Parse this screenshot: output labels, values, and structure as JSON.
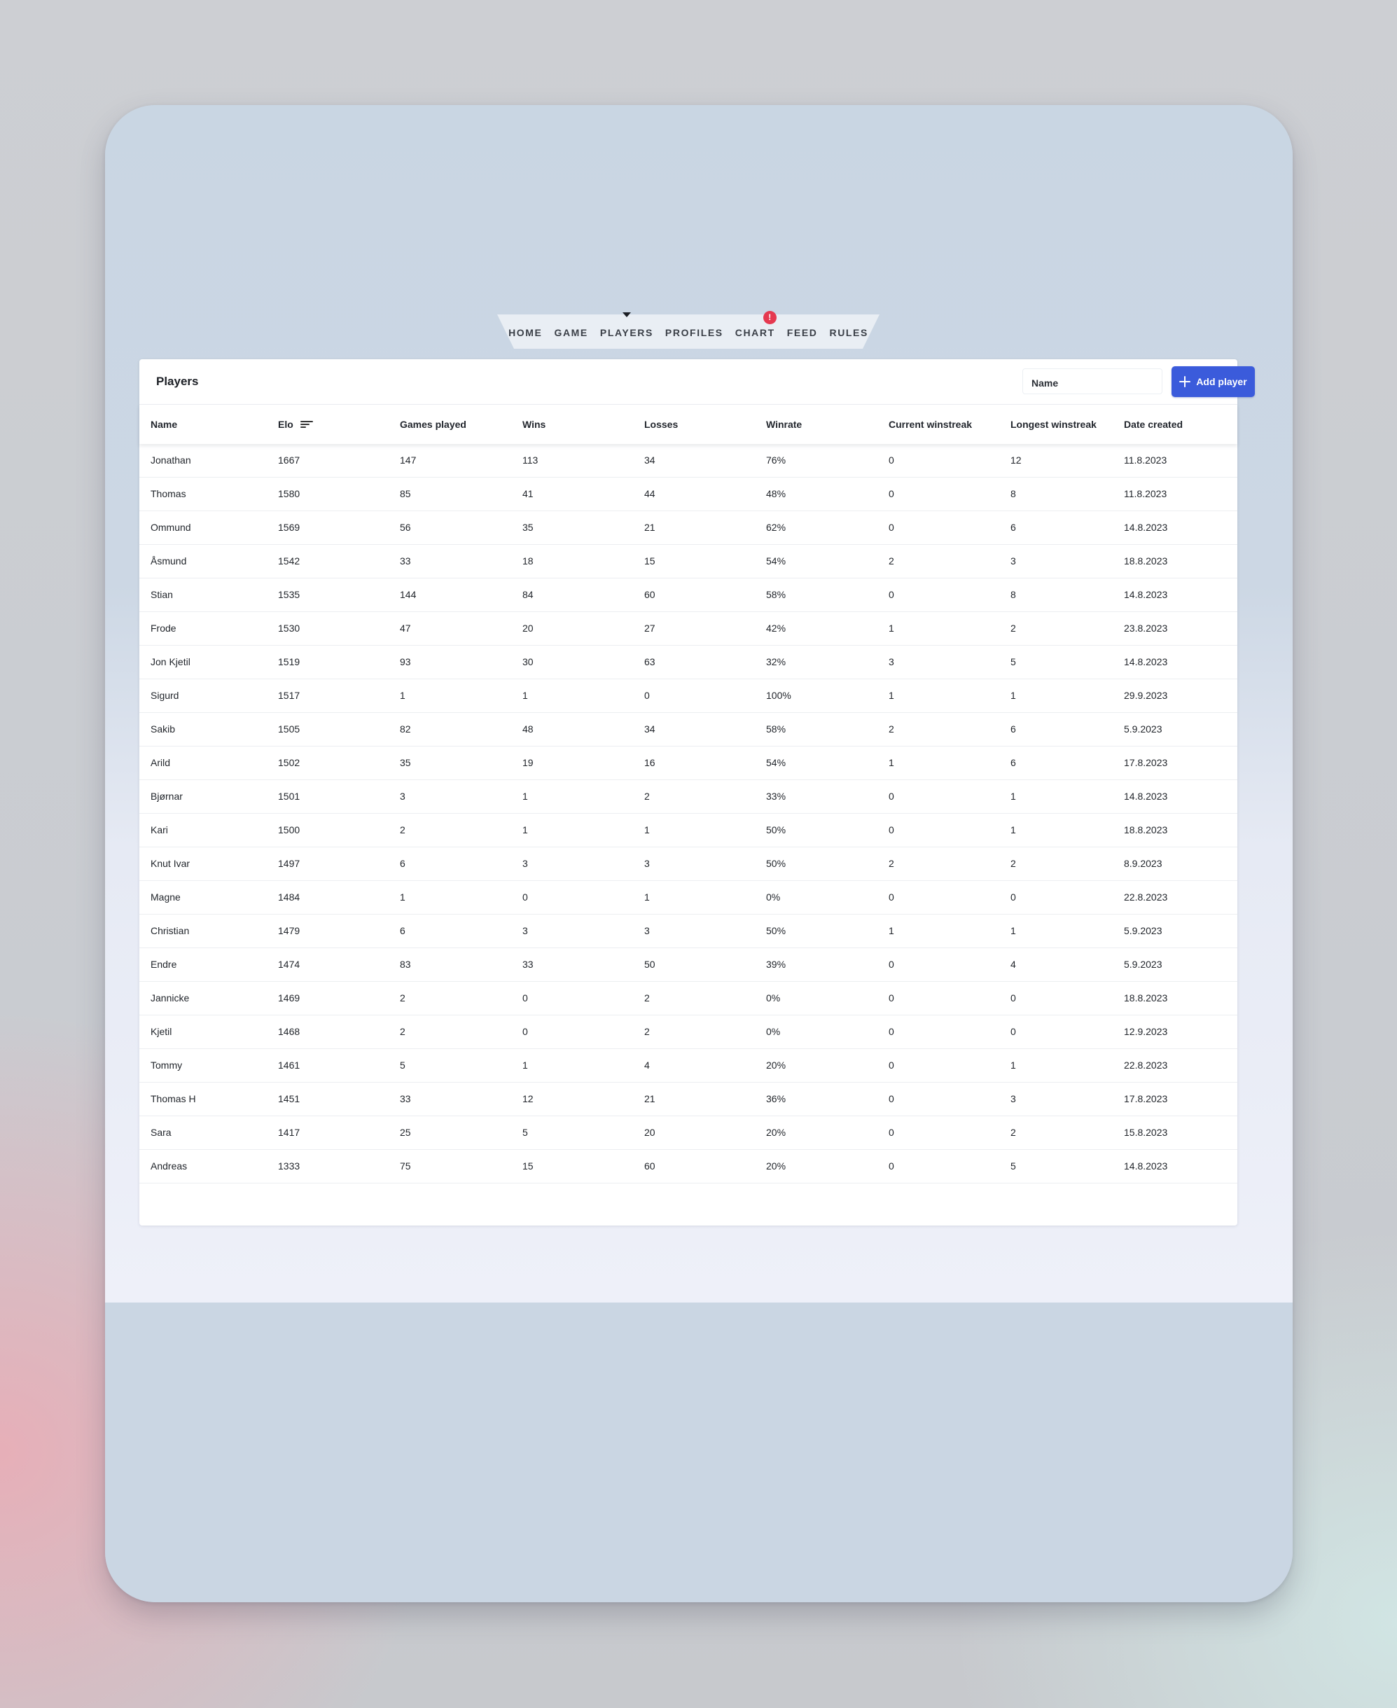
{
  "nav": {
    "items": [
      "HOME",
      "GAME",
      "PLAYERS",
      "PROFILES",
      "CHART",
      "FEED",
      "RULES"
    ],
    "active": "PLAYERS",
    "badge": "!"
  },
  "panel": {
    "title": "Players",
    "search_placeholder": "Name",
    "add_button_label": "Add player"
  },
  "table": {
    "columns": [
      "Name",
      "Elo",
      "Games played",
      "Wins",
      "Losses",
      "Winrate",
      "Current winstreak",
      "Longest winstreak",
      "Date created"
    ],
    "sorted_by": "Elo",
    "rows": [
      [
        "Jonathan",
        "1667",
        "147",
        "113",
        "34",
        "76%",
        "0",
        "12",
        "11.8.2023"
      ],
      [
        "Thomas",
        "1580",
        "85",
        "41",
        "44",
        "48%",
        "0",
        "8",
        "11.8.2023"
      ],
      [
        "Ommund",
        "1569",
        "56",
        "35",
        "21",
        "62%",
        "0",
        "6",
        "14.8.2023"
      ],
      [
        "Åsmund",
        "1542",
        "33",
        "18",
        "15",
        "54%",
        "2",
        "3",
        "18.8.2023"
      ],
      [
        "Stian",
        "1535",
        "144",
        "84",
        "60",
        "58%",
        "0",
        "8",
        "14.8.2023"
      ],
      [
        "Frode",
        "1530",
        "47",
        "20",
        "27",
        "42%",
        "1",
        "2",
        "23.8.2023"
      ],
      [
        "Jon Kjetil",
        "1519",
        "93",
        "30",
        "63",
        "32%",
        "3",
        "5",
        "14.8.2023"
      ],
      [
        "Sigurd",
        "1517",
        "1",
        "1",
        "0",
        "100%",
        "1",
        "1",
        "29.9.2023"
      ],
      [
        "Sakib",
        "1505",
        "82",
        "48",
        "34",
        "58%",
        "2",
        "6",
        "5.9.2023"
      ],
      [
        "Arild",
        "1502",
        "35",
        "19",
        "16",
        "54%",
        "1",
        "6",
        "17.8.2023"
      ],
      [
        "Bjørnar",
        "1501",
        "3",
        "1",
        "2",
        "33%",
        "0",
        "1",
        "14.8.2023"
      ],
      [
        "Kari",
        "1500",
        "2",
        "1",
        "1",
        "50%",
        "0",
        "1",
        "18.8.2023"
      ],
      [
        "Knut Ivar",
        "1497",
        "6",
        "3",
        "3",
        "50%",
        "2",
        "2",
        "8.9.2023"
      ],
      [
        "Magne",
        "1484",
        "1",
        "0",
        "1",
        "0%",
        "0",
        "0",
        "22.8.2023"
      ],
      [
        "Christian",
        "1479",
        "6",
        "3",
        "3",
        "50%",
        "1",
        "1",
        "5.9.2023"
      ],
      [
        "Endre",
        "1474",
        "83",
        "33",
        "50",
        "39%",
        "0",
        "4",
        "5.9.2023"
      ],
      [
        "Jannicke",
        "1469",
        "2",
        "0",
        "2",
        "0%",
        "0",
        "0",
        "18.8.2023"
      ],
      [
        "Kjetil",
        "1468",
        "2",
        "0",
        "2",
        "0%",
        "0",
        "0",
        "12.9.2023"
      ],
      [
        "Tommy",
        "1461",
        "5",
        "1",
        "4",
        "20%",
        "0",
        "1",
        "22.8.2023"
      ],
      [
        "Thomas H",
        "1451",
        "33",
        "12",
        "21",
        "36%",
        "0",
        "3",
        "17.8.2023"
      ],
      [
        "Sara",
        "1417",
        "25",
        "5",
        "20",
        "20%",
        "0",
        "2",
        "15.8.2023"
      ],
      [
        "Andreas",
        "1333",
        "75",
        "15",
        "60",
        "20%",
        "0",
        "5",
        "14.8.2023"
      ]
    ]
  },
  "icons": {
    "sort": "sort-icon",
    "add": "plus-icon",
    "nav_indicator": "caret-down-icon"
  },
  "colors": {
    "accent": "#3b5bdb",
    "badge": "#e53950"
  }
}
